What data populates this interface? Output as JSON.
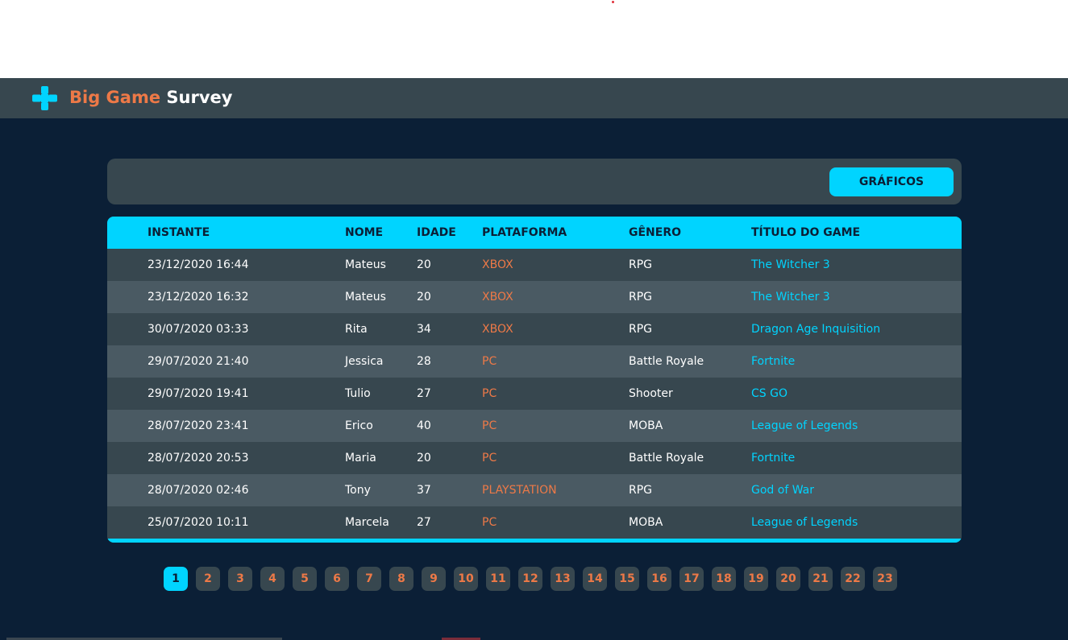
{
  "brand": {
    "part1": "Big Game",
    "part2": "Survey"
  },
  "filter": {
    "graphs_label": "GRÁFICOS"
  },
  "table": {
    "headers": [
      "INSTANTE",
      "NOME",
      "IDADE",
      "PLATAFORMA",
      "GÊNERO",
      "TÍTULO DO GAME"
    ],
    "rows": [
      [
        "23/12/2020 16:44",
        "Mateus",
        "20",
        "XBOX",
        "RPG",
        "The Witcher 3"
      ],
      [
        "23/12/2020 16:32",
        "Mateus",
        "20",
        "XBOX",
        "RPG",
        "The Witcher 3"
      ],
      [
        "30/07/2020 03:33",
        "Rita",
        "34",
        "XBOX",
        "RPG",
        "Dragon Age Inquisition"
      ],
      [
        "29/07/2020 21:40",
        "Jessica",
        "28",
        "PC",
        "Battle Royale",
        "Fortnite"
      ],
      [
        "29/07/2020 19:41",
        "Tulio",
        "27",
        "PC",
        "Shooter",
        "CS GO"
      ],
      [
        "28/07/2020 23:41",
        "Erico",
        "40",
        "PC",
        "MOBA",
        "League of Legends"
      ],
      [
        "28/07/2020 20:53",
        "Maria",
        "20",
        "PC",
        "Battle Royale",
        "Fortnite"
      ],
      [
        "28/07/2020 02:46",
        "Tony",
        "37",
        "PLAYSTATION",
        "RPG",
        "God of War"
      ],
      [
        "25/07/2020 10:11",
        "Marcela",
        "27",
        "PC",
        "MOBA",
        "League of Legends"
      ]
    ]
  },
  "pagination": {
    "pages": [
      "1",
      "2",
      "3",
      "4",
      "5",
      "6",
      "7",
      "8",
      "9",
      "10",
      "11",
      "12",
      "13",
      "14",
      "15",
      "16",
      "17",
      "18",
      "19",
      "20",
      "21",
      "22",
      "23"
    ],
    "active": "1"
  },
  "colors": {
    "accent": "#00d4ff",
    "brand_orange": "#ed7947",
    "background": "#0b1f36",
    "panel": "#37474f"
  },
  "icons": {
    "logo": "gamepad-dpad-icon"
  }
}
